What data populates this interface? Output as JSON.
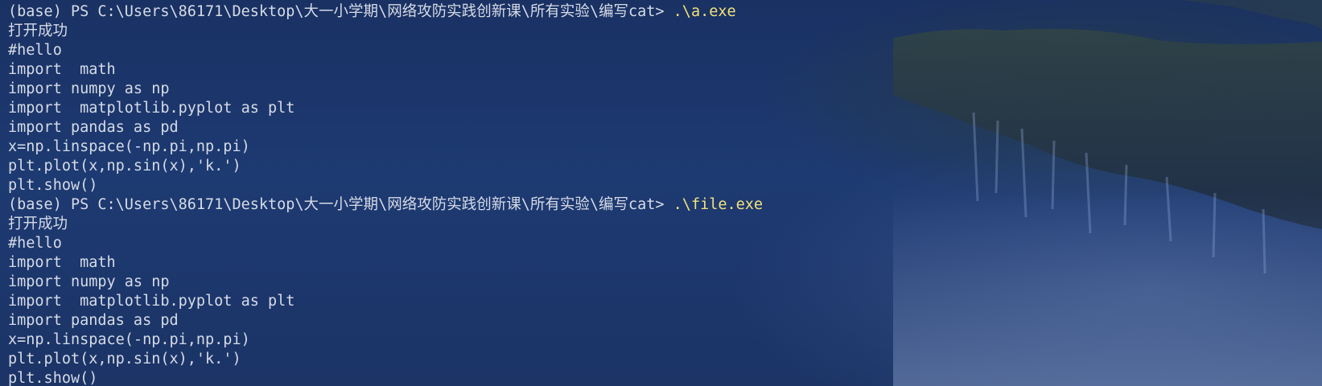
{
  "terminal": {
    "prompt": "(base) PS C:\\Users\\86171\\Desktop\\大一小学期\\网络攻防实践创新课\\所有实验\\编写cat> ",
    "sessions": [
      {
        "command": ".\\a.exe",
        "output": [
          "打开成功",
          "#hello",
          "import  math",
          "import numpy as np",
          "import  matplotlib.pyplot as plt",
          "import pandas as pd",
          "x=np.linspace(-np.pi,np.pi)",
          "plt.plot(x,np.sin(x),'k.')",
          "plt.show()"
        ]
      },
      {
        "command": ".\\file.exe",
        "output": [
          "打开成功",
          "#hello",
          "import  math",
          "import numpy as np",
          "import  matplotlib.pyplot as plt",
          "import pandas as pd",
          "x=np.linspace(-np.pi,np.pi)",
          "plt.plot(x,np.sin(x),'k.')",
          "plt.show()"
        ]
      }
    ]
  },
  "colors": {
    "background": "#1b3567",
    "text": "#d6dbe6",
    "command": "#f2e27a"
  }
}
